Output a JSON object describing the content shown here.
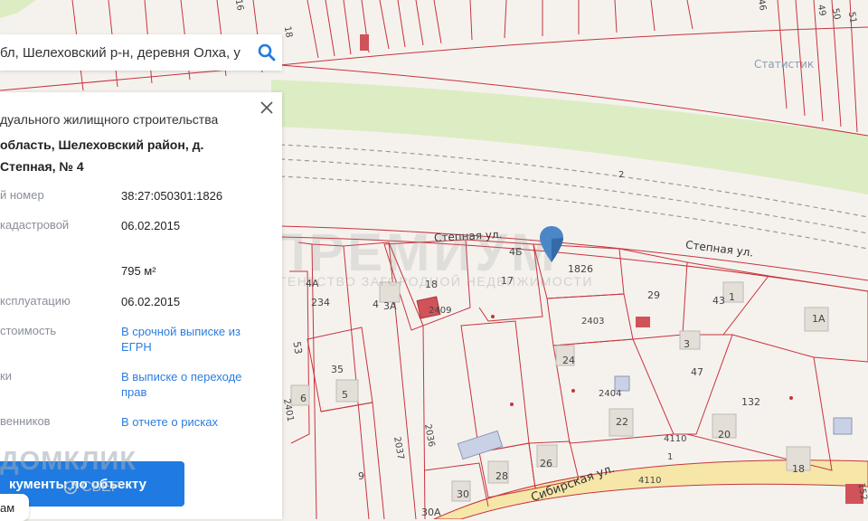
{
  "search": {
    "query": "бл, Шелеховский р-н, деревня Олха, у"
  },
  "panel": {
    "purpose": "дуального жилищного строительства",
    "address": "область, Шелеховский район, д. Степная, № 4",
    "rows": [
      {
        "label": "й номер",
        "value": "38:27:050301:1826"
      },
      {
        "label": "кадастровой",
        "value": "06.02.2015"
      },
      {
        "label": "",
        "value": "795 м²"
      },
      {
        "label": "ксплуатацию",
        "value": "06.02.2015"
      },
      {
        "label": "стоимость",
        "value": "В срочной выписке из ЕГРН"
      },
      {
        "label": "ки",
        "value": "В выписке о переходе прав"
      },
      {
        "label": "венников",
        "value": "В отчете о рисках"
      }
    ],
    "docs_button": "кументы по объекту",
    "chip_label": "ам"
  },
  "watermarks": {
    "domclick": "ДОМКЛИК",
    "sber": "СБЕР",
    "premium": "ПРЕМИУМ",
    "premium_sub": "АГЕНТСТВО ЗАГОРОДНОЙ НЕДВИЖИМОСТИ"
  },
  "map": {
    "streets": {
      "stepnaya_1": "Степная ул.",
      "stepnaya_2": "Степная ул.",
      "sibirskaya": "Сибирская ул.",
      "statistic": "Статистик"
    },
    "parcel_labels": [
      {
        "id": "4Б",
        "text": "4Б"
      },
      {
        "id": "1826",
        "text": "1826"
      },
      {
        "id": "17",
        "text": "17"
      },
      {
        "id": "18",
        "text": "18"
      },
      {
        "id": "2409",
        "text": "2409"
      },
      {
        "id": "3А",
        "text": "3А"
      },
      {
        "id": "4",
        "text": "4"
      },
      {
        "id": "4А",
        "text": "4А"
      },
      {
        "id": "234",
        "text": "234"
      },
      {
        "id": "53",
        "text": "53"
      },
      {
        "id": "35",
        "text": "35"
      },
      {
        "id": "5",
        "text": "5"
      },
      {
        "id": "6",
        "text": "6"
      },
      {
        "id": "2401",
        "text": "2401"
      },
      {
        "id": "9",
        "text": "9"
      },
      {
        "id": "2037",
        "text": "2037"
      },
      {
        "id": "2036",
        "text": "2036"
      },
      {
        "id": "28",
        "text": "28"
      },
      {
        "id": "26",
        "text": "26"
      },
      {
        "id": "30",
        "text": "30"
      },
      {
        "id": "30А",
        "text": "30А"
      },
      {
        "id": "2403",
        "text": "2403"
      },
      {
        "id": "24",
        "text": "24"
      },
      {
        "id": "2404",
        "text": "2404"
      },
      {
        "id": "22",
        "text": "22"
      },
      {
        "id": "29",
        "text": "29"
      },
      {
        "id": "43",
        "text": "43"
      },
      {
        "id": "1",
        "text": "1"
      },
      {
        "id": "3",
        "text": "3"
      },
      {
        "id": "47",
        "text": "47"
      },
      {
        "id": "132",
        "text": "132"
      },
      {
        "id": "20",
        "text": "20"
      },
      {
        "id": "18b",
        "text": "18"
      },
      {
        "id": "1А",
        "text": "1А"
      },
      {
        "id": "4110a",
        "text": "4110"
      },
      {
        "id": "4110b",
        "text": "4110"
      },
      {
        "id": "1b",
        "text": "1"
      },
      {
        "id": "2",
        "text": "2"
      },
      {
        "id": "152",
        "text": "152"
      },
      {
        "id": "18top",
        "text": "18"
      },
      {
        "id": "16",
        "text": "16"
      },
      {
        "id": "49",
        "text": "49"
      },
      {
        "id": "50",
        "text": "50"
      },
      {
        "id": "51",
        "text": "51"
      },
      {
        "id": "46",
        "text": "46"
      }
    ]
  },
  "colors": {
    "accent": "#1f7be1",
    "parcel_line": "#c8333b",
    "green_strip": "#d9ecbf",
    "marker": "#4a86c8"
  }
}
